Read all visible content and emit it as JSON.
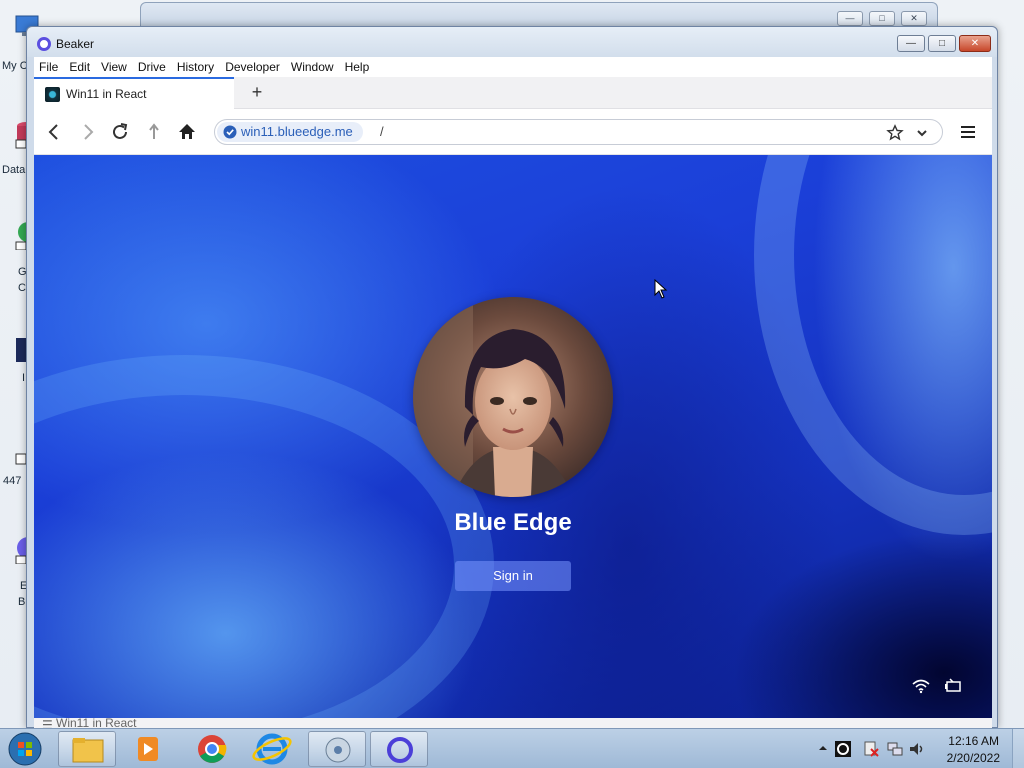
{
  "desktop": {
    "icon_labels": [
      "My C",
      "Data",
      "G",
      "C",
      "I",
      "447",
      "E",
      "B"
    ]
  },
  "browser": {
    "app_title": "Beaker",
    "menu": [
      "File",
      "Edit",
      "View",
      "Drive",
      "History",
      "Developer",
      "Window",
      "Help"
    ],
    "tab": {
      "title": "Win11 in React",
      "new_tab_label": "+"
    },
    "address": {
      "host": "win11.blueedge.me",
      "path": "/"
    },
    "status_text": "Win11 in React"
  },
  "page": {
    "user_name": "Blue Edge",
    "signin_label": "Sign in"
  },
  "taskbar": {
    "time": "12:16 AM",
    "date": "2/20/2022"
  },
  "colors": {
    "accent": "#2a6ae0",
    "beaker_logo": "#5b4fe0",
    "wallpaper": "#1b3fd8"
  }
}
